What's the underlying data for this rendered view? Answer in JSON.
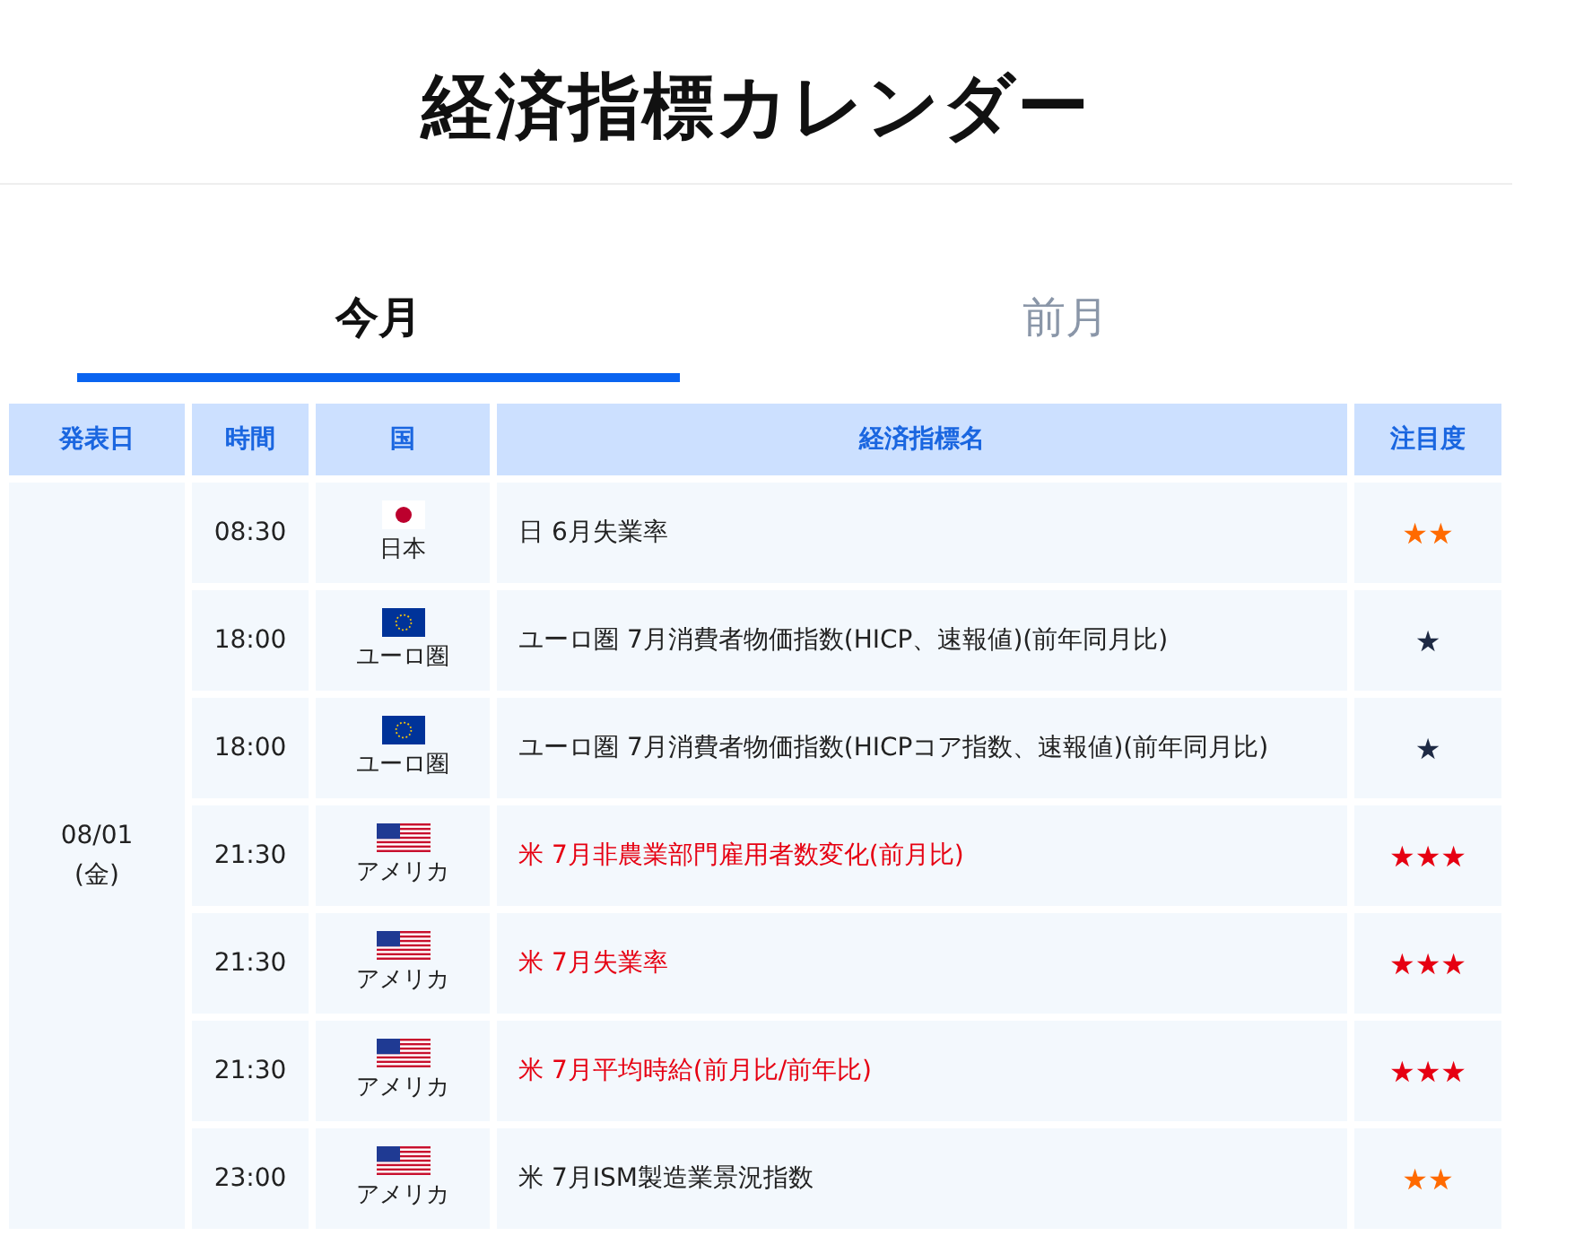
{
  "page_title": "経済指標カレンダー",
  "tabs": [
    {
      "label": "今月",
      "selected": true
    },
    {
      "label": "前月",
      "selected": false
    }
  ],
  "table": {
    "columns": [
      "発表日",
      "時間",
      "国",
      "経済指標名",
      "注目度"
    ],
    "date_group": {
      "date": "08/01",
      "weekday": "(金)"
    },
    "rows": [
      {
        "time": "08:30",
        "kind": "jp",
        "country": "日本",
        "indicator": "日 6月失業率",
        "important": false,
        "rating": "★★",
        "color": "#ff6a00"
      },
      {
        "time": "18:00",
        "kind": "eu",
        "country": "ユーロ圏",
        "indicator": "ユーロ圏 7月消費者物価指数(HICP、速報値)(前年同月比)",
        "important": false,
        "rating": "★",
        "color": "#1e2a44"
      },
      {
        "time": "18:00",
        "kind": "eu",
        "country": "ユーロ圏",
        "indicator": "ユーロ圏 7月消費者物価指数(HICPコア指数、速報値)(前年同月比)",
        "important": false,
        "rating": "★",
        "color": "#1e2a44"
      },
      {
        "time": "21:30",
        "kind": "us",
        "country": "アメリカ",
        "indicator": "米 7月非農業部門雇用者数変化(前月比)",
        "important": true,
        "rating": "★★★",
        "color": "#e60012"
      },
      {
        "time": "21:30",
        "kind": "us",
        "country": "アメリカ",
        "indicator": "米 7月失業率",
        "important": true,
        "rating": "★★★",
        "color": "#e60012"
      },
      {
        "time": "21:30",
        "kind": "us",
        "country": "アメリカ",
        "indicator": "米 7月平均時給(前月比/前年比)",
        "important": true,
        "rating": "★★★",
        "color": "#e60012"
      },
      {
        "time": "23:00",
        "kind": "us",
        "country": "アメリカ",
        "indicator": "米 7月ISM製造業景況指数",
        "important": false,
        "rating": "★★",
        "color": "#ff6a00"
      }
    ]
  }
}
